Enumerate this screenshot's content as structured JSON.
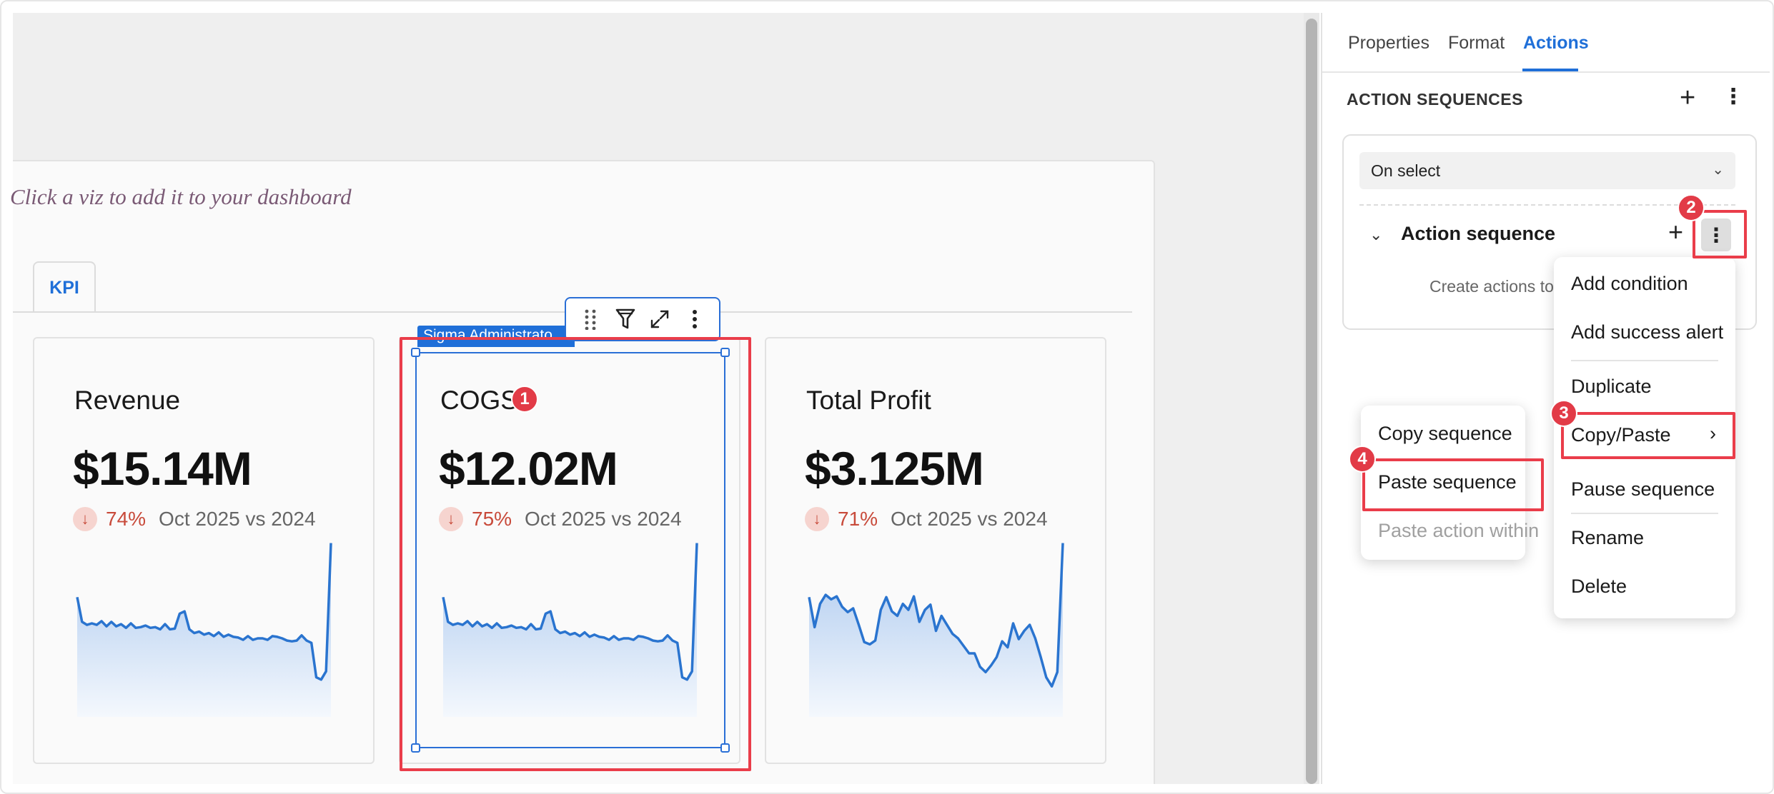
{
  "dashboard": {
    "hint": "Click a viz to add it to your dashboard",
    "tab": "KPI",
    "cards": [
      {
        "title": "Revenue",
        "value": "$15.14M",
        "delta_pct": "74%",
        "period": "Oct 2025 vs 2024"
      },
      {
        "title": "COGS",
        "value": "$12.02M",
        "delta_pct": "75%",
        "period": "Oct 2025 vs 2024"
      },
      {
        "title": "Total Profit",
        "value": "$3.125M",
        "delta_pct": "71%",
        "period": "Oct 2025 vs 2024"
      }
    ],
    "selection_tag": "Sigma Administrato",
    "arrow_glyph": "↓"
  },
  "sparklines": [
    [
      0.55,
      0.22,
      0.18,
      0.2,
      0.18,
      0.23,
      0.16,
      0.22,
      0.16,
      0.19,
      0.14,
      0.2,
      0.14,
      0.15,
      0.17,
      0.14,
      0.15,
      0.12,
      0.19,
      0.12,
      0.13,
      0.33,
      0.36,
      0.12,
      0.07,
      0.09,
      0.05,
      0.07,
      0.03,
      0.08,
      0.02,
      0.05,
      0.02,
      0.01,
      -0.02,
      0.03,
      -0.02,
      0.0,
      0.0,
      -0.02,
      0.03,
      0.02,
      0.0,
      -0.03,
      -0.04,
      -0.03,
      0.04,
      -0.03,
      -0.06,
      -0.52,
      -0.55,
      -0.44,
      1.27
    ],
    [
      0.55,
      0.22,
      0.18,
      0.2,
      0.18,
      0.23,
      0.16,
      0.22,
      0.16,
      0.19,
      0.14,
      0.2,
      0.14,
      0.15,
      0.17,
      0.14,
      0.15,
      0.12,
      0.19,
      0.12,
      0.13,
      0.33,
      0.36,
      0.12,
      0.07,
      0.09,
      0.05,
      0.07,
      0.03,
      0.08,
      0.02,
      0.05,
      0.02,
      0.01,
      -0.02,
      0.03,
      -0.02,
      0.0,
      0.0,
      -0.02,
      0.03,
      0.02,
      0.0,
      -0.03,
      -0.04,
      -0.03,
      0.04,
      -0.03,
      -0.06,
      -0.52,
      -0.55,
      -0.44,
      1.27
    ],
    [
      0.55,
      0.15,
      0.46,
      0.58,
      0.52,
      0.56,
      0.42,
      0.35,
      0.4,
      0.18,
      -0.05,
      -0.08,
      -0.03,
      0.38,
      0.55,
      0.36,
      0.3,
      0.46,
      0.38,
      0.56,
      0.22,
      0.38,
      0.45,
      0.1,
      0.3,
      0.18,
      0.06,
      0.0,
      -0.1,
      -0.2,
      -0.2,
      -0.38,
      -0.45,
      -0.36,
      -0.25,
      -0.04,
      -0.12,
      0.2,
      -0.01,
      0.1,
      0.18,
      0.0,
      -0.25,
      -0.52,
      -0.64,
      -0.45,
      1.27
    ]
  ],
  "toolbar": {
    "drag_icon": "drag-handle-icon",
    "filter_icon": "filter-icon",
    "expand_icon": "expand-icon",
    "more_icon": "more-vertical-icon"
  },
  "badges": [
    "1",
    "2",
    "3",
    "4"
  ],
  "panel": {
    "tabs": [
      "Properties",
      "Format",
      "Actions"
    ],
    "active_tab": "Actions",
    "section_title": "ACTION SEQUENCES",
    "plus": "+",
    "more": "⋮",
    "trigger_select": "On select",
    "sequence_label": "Action sequence",
    "create_text": "Create actions to c"
  },
  "context_menu": {
    "items": [
      "Add condition",
      "Add success alert",
      "Duplicate",
      "Copy/Paste",
      "Pause sequence",
      "Rename",
      "Delete"
    ],
    "submenu_arrow": "›"
  },
  "submenu": {
    "items": [
      "Copy sequence",
      "Paste sequence",
      "Paste action within"
    ]
  },
  "colors": {
    "accent": "#1f6fd8",
    "highlight": "#ea3d4a",
    "delta": "#c84a3a",
    "spark_line": "#2a74cf"
  }
}
